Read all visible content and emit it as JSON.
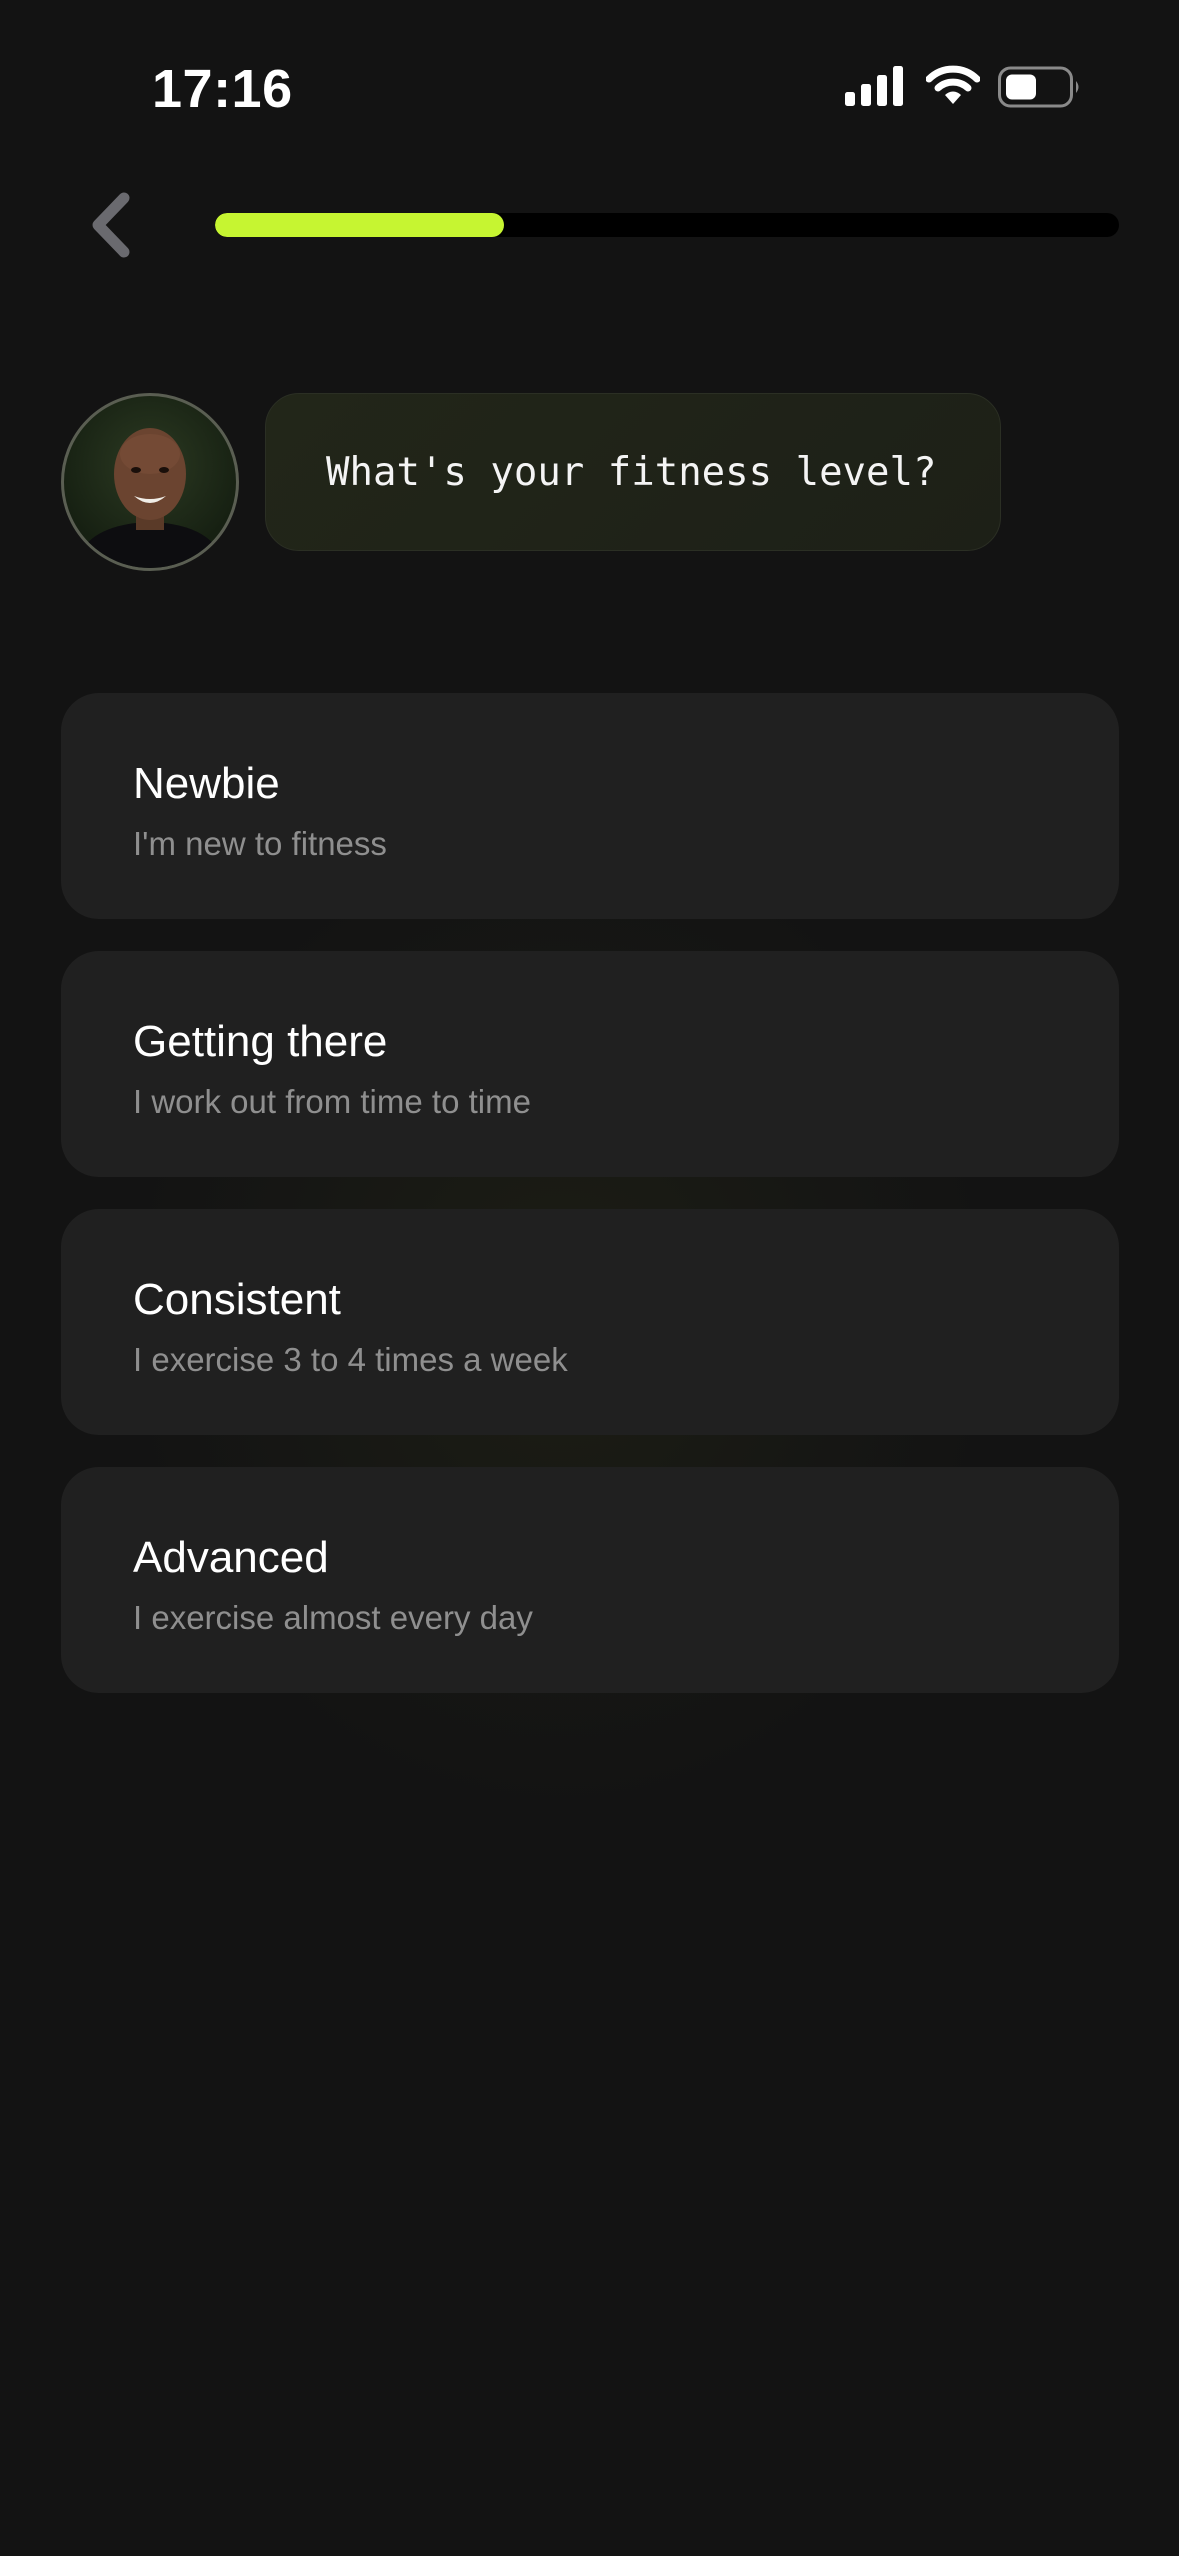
{
  "status_bar": {
    "time": "17:16",
    "icons": [
      "cellular-signal-icon",
      "wifi-icon",
      "battery-icon"
    ]
  },
  "header": {
    "back_icon": "chevron-left-icon",
    "progress_fraction": 0.32
  },
  "coach": {
    "avatar": "coach-avatar",
    "question": "What's your fitness level?"
  },
  "options": [
    {
      "title": "Newbie",
      "subtitle": "I'm new to fitness"
    },
    {
      "title": "Getting there",
      "subtitle": "I work out from time to time"
    },
    {
      "title": "Consistent",
      "subtitle": "I exercise 3 to 4 times a week"
    },
    {
      "title": "Advanced",
      "subtitle": "I exercise almost every day"
    }
  ],
  "colors": {
    "background": "#131313",
    "accent": "#c6f531",
    "card": "#202020",
    "subtitle_text": "#8f8f8f"
  }
}
